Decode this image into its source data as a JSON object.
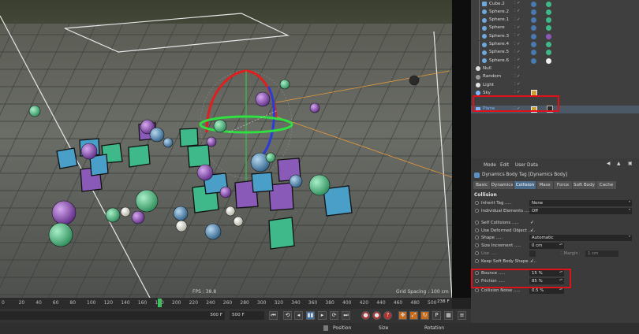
{
  "viewport": {
    "fps": "FPS : 38.8",
    "grid_spacing": "Grid Spacing : 100 cm"
  },
  "object_manager": {
    "objects": [
      {
        "name": "Cube.2",
        "icon": "cube-icon",
        "tag_color": "#3fb98a"
      },
      {
        "name": "Sphere.2",
        "icon": "sphere-icon",
        "tag_color": "#3fb98a"
      },
      {
        "name": "Sphere.1",
        "icon": "sphere-icon",
        "tag_color": "#3fb98a"
      },
      {
        "name": "Sphere",
        "icon": "sphere-icon",
        "tag_color": "#3fb98a"
      },
      {
        "name": "Sphere.3",
        "icon": "sphere-icon",
        "tag_color": "#8a5ab8"
      },
      {
        "name": "Sphere.4",
        "icon": "sphere-icon",
        "tag_color": "#3fb98a"
      },
      {
        "name": "Sphere.5",
        "icon": "sphere-icon",
        "tag_color": "#3fb98a"
      },
      {
        "name": "Sphere.6",
        "icon": "sphere-icon",
        "tag_color": "#f0f0f0"
      },
      {
        "name": "Null",
        "icon": "null-icon",
        "tag_color": ""
      },
      {
        "name": "Random",
        "icon": "random-effector-icon",
        "tag_color": ""
      },
      {
        "name": "Light",
        "icon": "light-icon",
        "tag_color": ""
      },
      {
        "name": "Sky",
        "icon": "sky-icon",
        "tag_color": ""
      },
      {
        "name": "Plane",
        "icon": "plane-icon",
        "tag_color": ""
      }
    ]
  },
  "attributes": {
    "menu": [
      "Mode",
      "Edit",
      "User Data"
    ],
    "title": "Dynamics Body Tag [Dynamics Body]",
    "tabs": [
      "Basic",
      "Dynamics",
      "Collision",
      "Mass",
      "Force",
      "Soft Body",
      "Cache"
    ],
    "active_tab": "Collision",
    "section": "Collision",
    "props": [
      {
        "label": "Inherit Tag",
        "value": "None",
        "kind": "dropdown"
      },
      {
        "label": "Individual Elements",
        "value": "Off",
        "kind": "dropdown"
      },
      {
        "label": "Self Collisions",
        "value": "✓",
        "kind": "check"
      },
      {
        "label": "Use Deformed Object",
        "value": "✓",
        "kind": "check"
      },
      {
        "label": "Shape",
        "value": "Automatic",
        "kind": "dropdown"
      },
      {
        "label": "Size Increment",
        "value": "0 cm",
        "kind": "field"
      },
      {
        "label": "Use",
        "value": "",
        "kind": "dim"
      },
      {
        "label": "Keep Soft Body Shape",
        "value": "✓",
        "kind": "check"
      },
      {
        "label": "Bounce",
        "value": "15 %",
        "kind": "field"
      },
      {
        "label": "Friction",
        "value": "85 %",
        "kind": "field"
      },
      {
        "label": "Collision Noise",
        "value": "0.5 %",
        "kind": "field"
      }
    ],
    "margin_label": "Margin",
    "margin_value": "1 cm"
  },
  "timeline": {
    "ticks": [
      "0",
      "20",
      "40",
      "60",
      "80",
      "100",
      "120",
      "140",
      "160",
      "180",
      "200",
      "220",
      "240",
      "260",
      "280",
      "300",
      "320",
      "340",
      "360",
      "380",
      "400",
      "420",
      "440",
      "460",
      "480",
      "500"
    ],
    "current_frame": "238 F"
  },
  "transport": {
    "start": "500 F",
    "end": "500 F"
  },
  "coords": {
    "position": "Position",
    "size": "Size",
    "rotation": "Rotation"
  }
}
